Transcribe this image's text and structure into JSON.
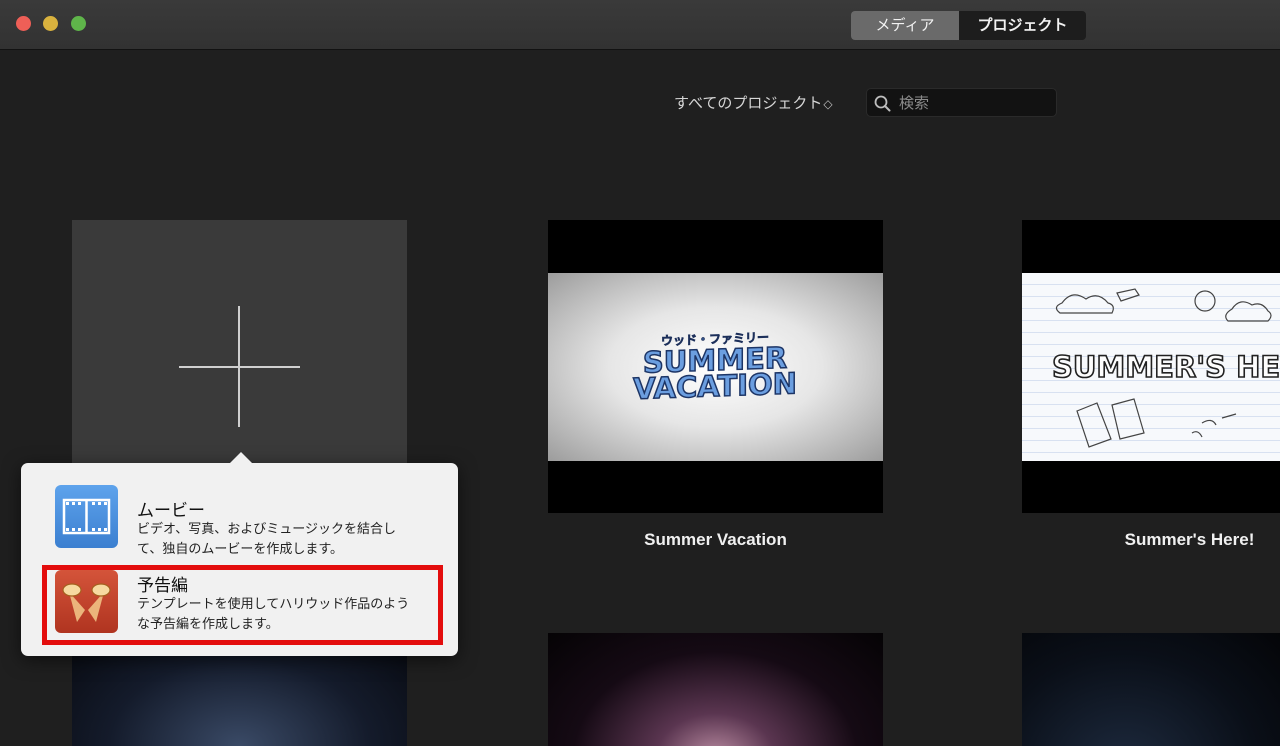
{
  "colors": {
    "window_bg": "#1f1f1f",
    "titlebar": "#353535",
    "highlight": "#e30d0d",
    "movie_icon": "#4a90d9",
    "trailer_icon": "#c8412a"
  },
  "toolbar": {
    "media_tab": "メディア",
    "projects_tab": "プロジェクト"
  },
  "filter": {
    "label": "すべてのプロジェクト",
    "chevron": "◇"
  },
  "search": {
    "placeholder": "検索",
    "value": ""
  },
  "projects": [
    {
      "title": "Summer Vacation",
      "thumb_kicker": "ウッド・ファミリー",
      "thumb_line1": "SUMMER",
      "thumb_line2": "VACATION"
    },
    {
      "title": "Summer's Here!",
      "thumb_text": "SUMMER'S HERE"
    }
  ],
  "new_project_menu": {
    "movie": {
      "title": "ムービー",
      "desc_line1": "ビデオ、写真、およびミュージックを結合し",
      "desc_line2": "て、独自のムービーを作成します。",
      "icon": "film-strip-icon"
    },
    "trailer": {
      "title": "予告編",
      "desc_line1": "テンプレートを使用してハリウッド作品のよう",
      "desc_line2": "な予告編を作成します。",
      "icon": "spotlight-icon"
    }
  }
}
